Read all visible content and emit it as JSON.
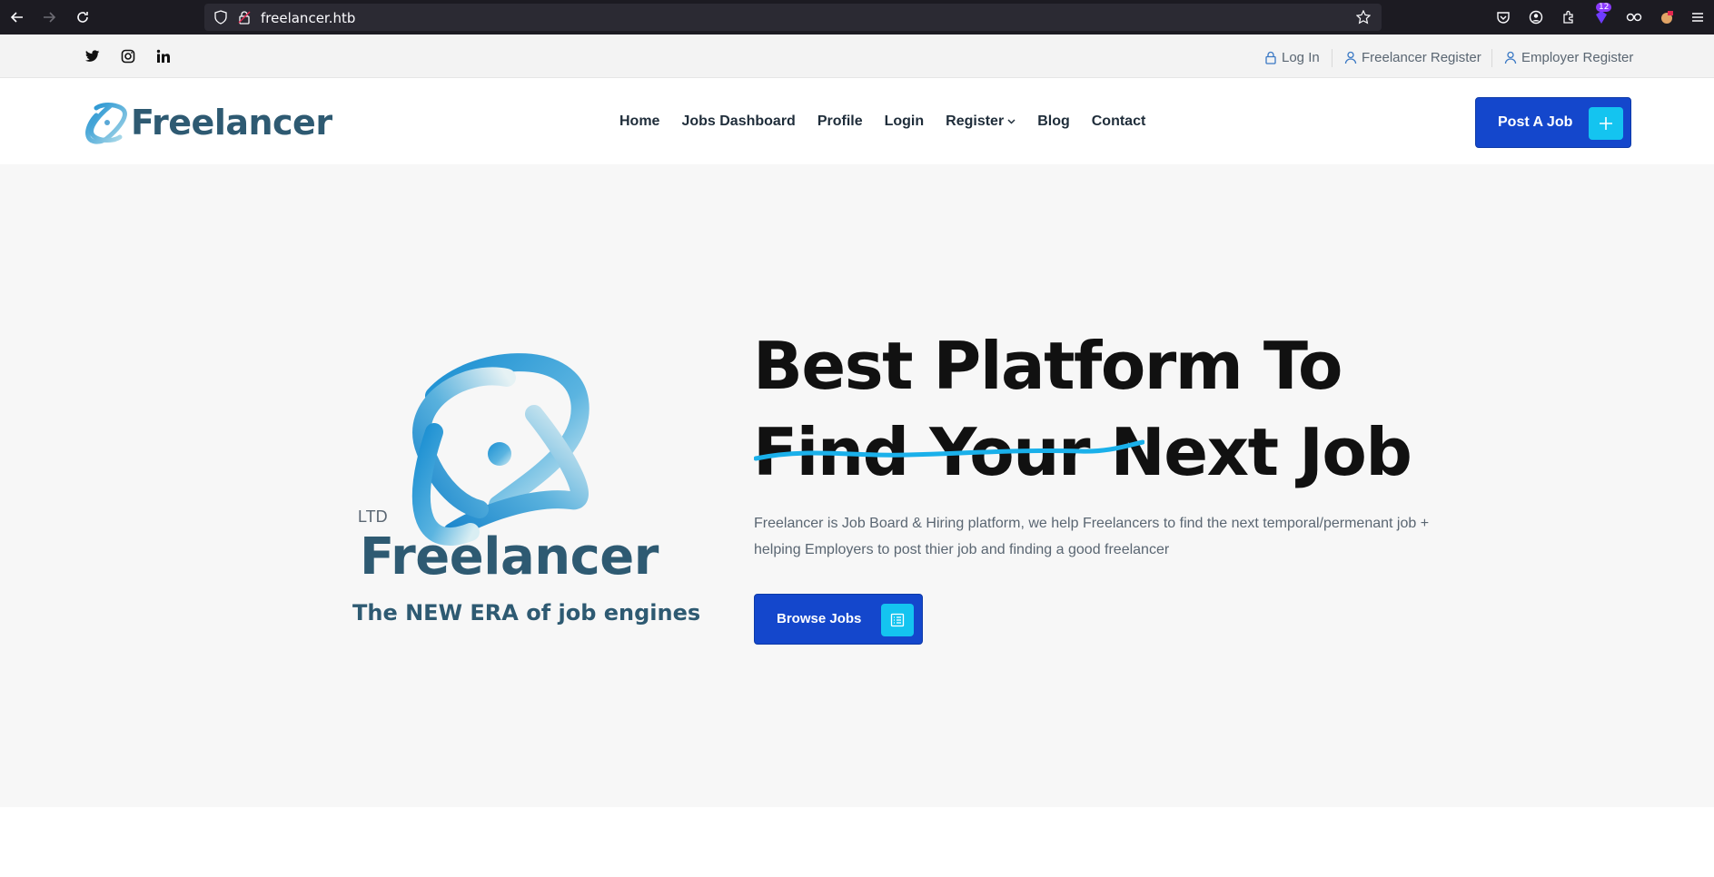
{
  "browser": {
    "url": "freelancer.htb",
    "extension_badge": "12"
  },
  "topbar": {
    "social": [
      "twitter",
      "instagram",
      "linkedin"
    ],
    "login_label": "Log In",
    "freelancer_register_label": "Freelancer Register",
    "employer_register_label": "Employer Register"
  },
  "header": {
    "logo_text": "Freelancer",
    "nav": [
      "Home",
      "Jobs Dashboard",
      "Profile",
      "Login",
      "Register",
      "Blog",
      "Contact"
    ],
    "post_job_label": "Post A Job"
  },
  "hero": {
    "ltd_label": "LTD",
    "brand_name": "Freelancer",
    "tagline": "The NEW ERA of job engines",
    "headline_line1": "Best Platform To",
    "headline_line2": "Find Your Next Job",
    "description": "Freelancer is Job Board & Hiring platform, we help Freelancers to find the next temporal/permenant job + helping Employers to post thier job and finding a good freelancer",
    "browse_label": "Browse Jobs"
  },
  "colors": {
    "brand_blue": "#1447cc",
    "accent_cyan": "#14c4f0",
    "logo_teal": "#2e5a72"
  }
}
